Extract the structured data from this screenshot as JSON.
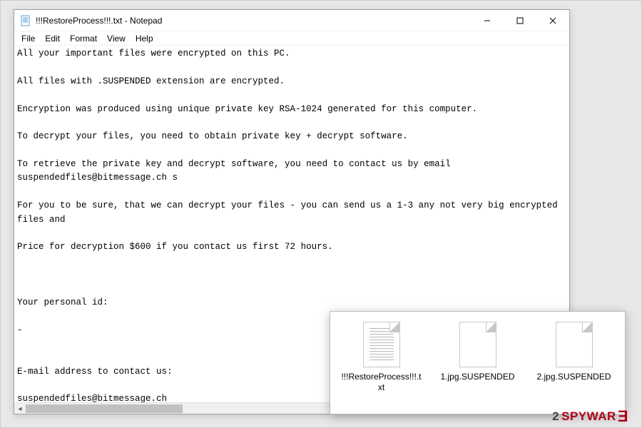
{
  "window": {
    "title": "!!!RestoreProcess!!!.txt - Notepad"
  },
  "menu": {
    "file": "File",
    "edit": "Edit",
    "format": "Format",
    "view": "View",
    "help": "Help"
  },
  "note_text": "All your important files were encrypted on this PC.\n\nAll files with .SUSPENDED extension are encrypted.\n\nEncryption was produced using unique private key RSA-1024 generated for this computer.\n\nTo decrypt your files, you need to obtain private key + decrypt software.\n\nTo retrieve the private key and decrypt software, you need to contact us by email suspendedfiles@bitmessage.ch s\n\nFor you to be sure, that we can decrypt your files - you can send us a 1-3 any not very big encrypted files and\n\nPrice for decryption $600 if you contact us first 72 hours.\n\n\n\nYour personal id:\n\n-\n\n\nE-mail address to contact us:\n\nsuspendedfiles@bitmessage.ch\n\n\n\nReserve email address to contact us:\n\nsuspendedfiles@india.com\n",
  "files": [
    {
      "name": "!!!RestoreProcess!!!.txt",
      "type": "txt"
    },
    {
      "name": "1.jpg.SUSPENDED",
      "type": "blank"
    },
    {
      "name": "2.jpg.SUSPENDED",
      "type": "blank"
    }
  ],
  "watermark": {
    "two": "2",
    "spy": "SPY",
    "war": "WAR",
    "tail": "Ǝ"
  }
}
